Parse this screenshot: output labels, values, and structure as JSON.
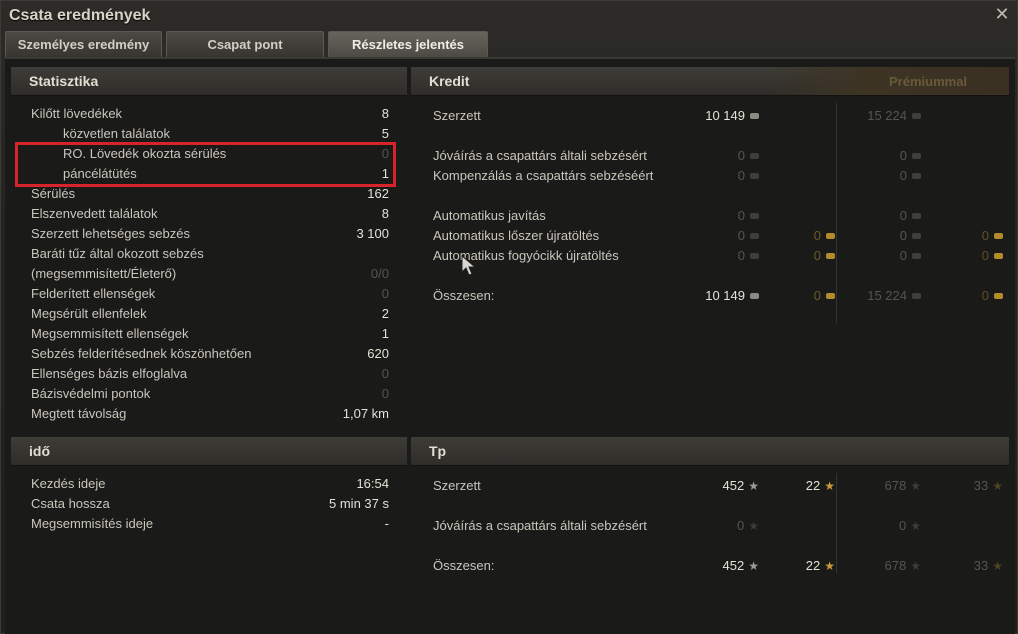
{
  "window": {
    "title": "Csata eredmények"
  },
  "tabs": [
    {
      "label": "Személyes eredmény"
    },
    {
      "label": "Csapat pont"
    },
    {
      "label": "Részletes jelentés",
      "active": true
    }
  ],
  "statistika": {
    "title": "Statisztika",
    "rows": [
      {
        "label": "Kilőtt lövedékek",
        "value": "8",
        "indent": false,
        "dim": false
      },
      {
        "label": "közvetlen találatok",
        "value": "5",
        "indent": true,
        "dim": false
      },
      {
        "label": "RO. Lövedék okozta sérülés",
        "value": "0",
        "indent": true,
        "dim": true
      },
      {
        "label": "páncélátütés",
        "value": "1",
        "indent": true,
        "dim": false
      },
      {
        "label": "Sérülés",
        "value": "162",
        "indent": false,
        "dim": false
      },
      {
        "label": "Elszenvedett találatok",
        "value": "8",
        "indent": false,
        "dim": false
      },
      {
        "label": "Szerzett lehetséges sebzés",
        "value": "3 100",
        "indent": false,
        "dim": false
      },
      {
        "label": "Baráti tűz által okozott sebzés",
        "value": "",
        "indent": false,
        "dim": false
      },
      {
        "label": "(megsemmisített/Életerő)",
        "value": "0/0",
        "indent": false,
        "dim": true
      },
      {
        "label": "Felderített ellenségek",
        "value": "0",
        "indent": false,
        "dim": true
      },
      {
        "label": "Megsérült ellenfelek",
        "value": "2",
        "indent": false,
        "dim": false
      },
      {
        "label": "Megsemmisített ellenségek",
        "value": "1",
        "indent": false,
        "dim": false
      },
      {
        "label": "Sebzés felderítésednek köszönhetően",
        "value": "620",
        "indent": false,
        "dim": false
      },
      {
        "label": "Ellenséges bázis elfoglalva",
        "value": "0",
        "indent": false,
        "dim": true
      },
      {
        "label": "Bázisvédelmi pontok",
        "value": "0",
        "indent": false,
        "dim": true
      },
      {
        "label": "Megtett távolság",
        "value": "1,07 km",
        "indent": false,
        "dim": false
      }
    ]
  },
  "ido": {
    "title": "idő",
    "rows": [
      {
        "label": "Kezdés ideje",
        "value": "16:54"
      },
      {
        "label": "Csata hossza",
        "value": "5 min 37 s"
      },
      {
        "label": "Megsemmisítés ideje",
        "value": "-"
      }
    ]
  },
  "kredit": {
    "title": "Kredit",
    "premium_label": "Prémiummal",
    "rows": [
      {
        "label": "Szerzett",
        "credit": "10 149",
        "gold": "",
        "p_credit": "15 224",
        "p_gold": "",
        "credit_dim": false,
        "gold_dim": true
      },
      {
        "label": "Jóváírás a csapattárs általi sebzésért",
        "credit": "0",
        "gold": "",
        "p_credit": "0",
        "p_gold": "",
        "credit_dim": true,
        "gold_dim": true
      },
      {
        "label": "Kompenzálás a csapattárs sebzéséért",
        "credit": "0",
        "gold": "",
        "p_credit": "0",
        "p_gold": "",
        "credit_dim": true,
        "gold_dim": true
      },
      {
        "label": "Automatikus javítás",
        "credit": "0",
        "gold": "",
        "p_credit": "0",
        "p_gold": "",
        "credit_dim": true,
        "gold_dim": true
      },
      {
        "label": "Automatikus lőszer újratöltés",
        "credit": "0",
        "gold": "0",
        "p_credit": "0",
        "p_gold": "0",
        "credit_dim": true,
        "gold_dim": true
      },
      {
        "label": "Automatikus fogyócikk újratöltés",
        "credit": "0",
        "gold": "0",
        "p_credit": "0",
        "p_gold": "0",
        "credit_dim": true,
        "gold_dim": true
      },
      {
        "label": "Összesen:",
        "credit": "10 149",
        "gold": "0",
        "p_credit": "15 224",
        "p_gold": "0",
        "credit_dim": false,
        "gold_dim": true
      }
    ]
  },
  "tp": {
    "title": "Tp",
    "rows": [
      {
        "label": "Szerzett",
        "xp": "452",
        "fxp": "22",
        "p_xp": "678",
        "p_fxp": "33",
        "xp_dim": false
      },
      {
        "label": "Jóváírás a csapattárs általi sebzésért",
        "xp": "0",
        "fxp": "",
        "p_xp": "0",
        "p_fxp": "",
        "xp_dim": true
      },
      {
        "label": "Összesen:",
        "xp": "452",
        "fxp": "22",
        "p_xp": "678",
        "p_fxp": "33",
        "xp_dim": false
      }
    ]
  },
  "colors": {
    "highlight": "#d8232a",
    "gold": "#b38a2c"
  }
}
